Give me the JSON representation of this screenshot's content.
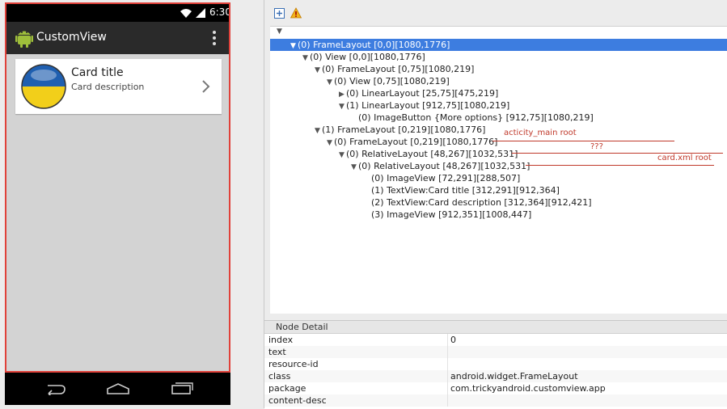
{
  "device": {
    "status_time": "6:30",
    "app_title": "CustomView",
    "card": {
      "title": "Card title",
      "description": "Card description"
    }
  },
  "tree": {
    "nodes": [
      {
        "label": "(0) FrameLayout [0,0][1080,1776]",
        "state": "expanded",
        "selected": true
      },
      {
        "label": "(0) View [0,0][1080,1776]",
        "state": "expanded"
      },
      {
        "label": "(0) FrameLayout [0,75][1080,219]",
        "state": "expanded"
      },
      {
        "label": "(0) View [0,75][1080,219]",
        "state": "expanded"
      },
      {
        "label": "(0) LinearLayout [25,75][475,219]",
        "state": "collapsed"
      },
      {
        "label": "(1) LinearLayout [912,75][1080,219]",
        "state": "expanded"
      },
      {
        "label": "(0) ImageButton {More options} [912,75][1080,219]",
        "state": "leaf"
      },
      {
        "label": "(1) FrameLayout [0,219][1080,1776]",
        "state": "expanded"
      },
      {
        "label": "(0) FrameLayout [0,219][1080,1776]",
        "state": "expanded"
      },
      {
        "label": "(0) RelativeLayout [48,267][1032,531]",
        "state": "expanded"
      },
      {
        "label": "(0) RelativeLayout [48,267][1032,531]",
        "state": "expanded"
      },
      {
        "label": "(0) ImageView [72,291][288,507]",
        "state": "leaf"
      },
      {
        "label": "(1) TextView:Card title [312,291][912,364]",
        "state": "leaf"
      },
      {
        "label": "(2) TextView:Card description [312,364][912,421]",
        "state": "leaf"
      },
      {
        "label": "(3) ImageView [912,351][1008,447]",
        "state": "leaf"
      }
    ],
    "annotations": [
      "acticity_main root",
      "???",
      "card.xml root"
    ]
  },
  "node_detail": {
    "header": "Node Detail",
    "rows": [
      {
        "key": "index",
        "value": "0"
      },
      {
        "key": "text",
        "value": ""
      },
      {
        "key": "resource-id",
        "value": ""
      },
      {
        "key": "class",
        "value": "android.widget.FrameLayout"
      },
      {
        "key": "package",
        "value": "com.trickyandroid.customview.app"
      },
      {
        "key": "content-desc",
        "value": ""
      }
    ]
  },
  "colors": {
    "selection": "#3d7de0",
    "annotation": "#c0392b",
    "frame_border": "#e0413a",
    "android_green": "#9fbf3b",
    "flag_blue": "#1f5fb0",
    "flag_yellow": "#f2cf1a"
  }
}
